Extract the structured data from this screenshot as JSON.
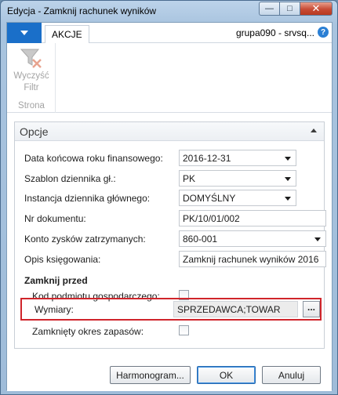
{
  "window": {
    "title": "Edycja - Zamknij rachunek wyników",
    "controls": {
      "minimize": "—",
      "maximize": "□",
      "close": "✕"
    }
  },
  "ribbon": {
    "tab": "AKCJE",
    "company": "grupa090 - srvsq...",
    "help": "?",
    "filter_label_line1": "Wyczyść",
    "filter_label_line2": "Filtr",
    "group_label": "Strona"
  },
  "panel": {
    "title": "Opcje"
  },
  "fields": {
    "data_konc": {
      "label": "Data końcowa roku finansowego:",
      "value": "2016-12-31"
    },
    "szablon": {
      "label": "Szablon dziennika gł.:",
      "value": "PK"
    },
    "instancja": {
      "label": "Instancja dziennika głównego:",
      "value": "DOMYŚLNY"
    },
    "nr_dok": {
      "label": "Nr dokumentu:",
      "value": "PK/10/01/002"
    },
    "konto": {
      "label": "Konto zysków zatrzymanych:",
      "value": "860-001"
    },
    "opis": {
      "label": "Opis księgowania:",
      "value": "Zamknij rachunek wyników 2016"
    }
  },
  "section": {
    "title": "Zamknij przed",
    "kod_label": "Kod podmiotu gospodarczego:",
    "kod_checked": false,
    "wymiary_label": "Wymiary:",
    "wymiary_value": "SPRZEDAWCA;TOWAR",
    "ellipsis": "...",
    "zapasy_label": "Zamknięty okres zapasów:",
    "zapasy_checked": false
  },
  "buttons": {
    "harmonogram": "Harmonogram...",
    "ok": "OK",
    "anuluj": "Anuluj"
  },
  "colors": {
    "app_button": "#1a6fc9",
    "highlight_border": "#d0252b"
  }
}
